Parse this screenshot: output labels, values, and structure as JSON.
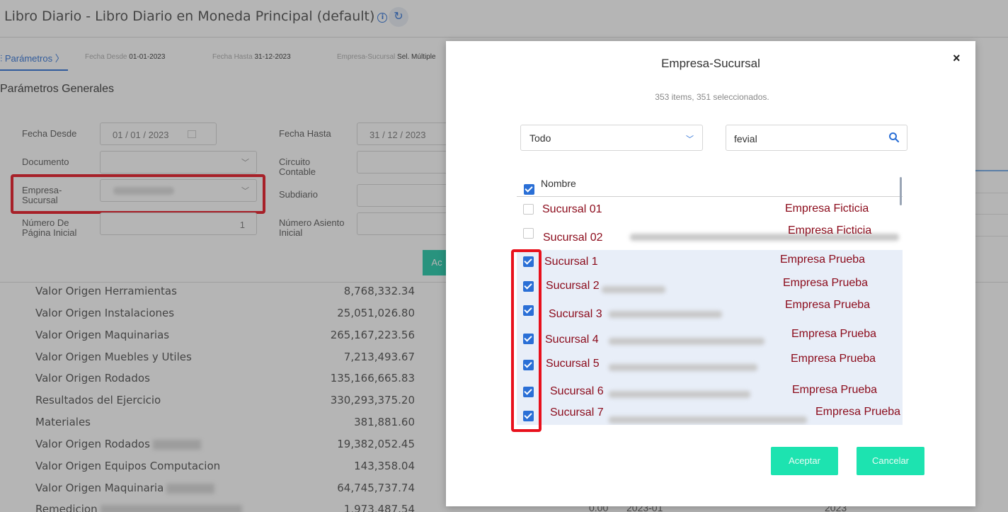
{
  "page": {
    "title": "Libro Diario - Libro Diario en Moneda Principal (default)",
    "param_tab": "Parámetros",
    "param_chips": [
      {
        "label": "Fecha Desde",
        "value": "01-01-2023"
      },
      {
        "label": "Fecha Hasta",
        "value": "31-12-2023"
      },
      {
        "label": "Empresa-Sucursal",
        "value": "Sel. Múltiple"
      }
    ],
    "section_title": "Parámetros Generales",
    "form": {
      "fecha_desde_label": "Fecha Desde",
      "fecha_desde_value": "01 / 01 / 2023",
      "documento_label": "Documento",
      "empresa_sucursal_label": "Empresa-\nSucursal",
      "numero_pagina_label": "Número De\nPágina Inicial",
      "numero_pagina_value": "1",
      "fecha_hasta_label": "Fecha Hasta",
      "fecha_hasta_value": "31 / 12 / 2023",
      "circuito_label": "Circuito\nContable",
      "subdiario_label": "Subdiario",
      "numero_asiento_label": "Número Asiento\nInicial",
      "aceptar_partial": "Ac"
    },
    "rows": [
      {
        "account": "Valor Origen Herramientas",
        "amount": "8,768,332.34"
      },
      {
        "account": "Valor Origen Instalaciones",
        "amount": "25,051,026.80"
      },
      {
        "account": "Valor Origen Maquinarias",
        "amount": "265,167,223.56"
      },
      {
        "account": "Valor Origen Muebles y Utiles",
        "amount": "7,213,493.67"
      },
      {
        "account": "Valor Origen Rodados",
        "amount": "135,166,665.83"
      },
      {
        "account": "Resultados del Ejercicio",
        "amount": "330,293,375.20"
      },
      {
        "account": "Materiales",
        "amount": "381,881.60"
      },
      {
        "account": "Valor Origen Rodados",
        "amount": "19,382,052.45"
      },
      {
        "account": "Valor Origen Equipos Computacion",
        "amount": "143,358.04"
      },
      {
        "account": "Valor Origen Maquinaria",
        "amount": "64,745,737.74"
      },
      {
        "account": "Remedicion",
        "amount": "1,973,487.54"
      }
    ],
    "bottom_extra": {
      "zero": "0.00",
      "period": "2023-01",
      "year": "2023"
    }
  },
  "modal": {
    "title": "Empresa-Sucursal",
    "close_label": "×",
    "subtitle": "353 items, 351 seleccionados.",
    "filter_value": "Todo",
    "search_value": "fevial",
    "column_header": "Nombre",
    "items": [
      {
        "name": "Sucursal 01",
        "company": "Empresa Ficticia",
        "checked": false
      },
      {
        "name": "Sucursal 02",
        "company": "Empresa Ficticia",
        "checked": false
      },
      {
        "name": "Sucursal 1",
        "company": "Empresa Prueba",
        "checked": true
      },
      {
        "name": "Sucursal 2",
        "company": "Empresa Prueba",
        "checked": true
      },
      {
        "name": "Sucursal 3",
        "company": "Empresa Prueba",
        "checked": true
      },
      {
        "name": "Sucursal 4",
        "company": "Empresa Prueba",
        "checked": true
      },
      {
        "name": "Sucursal 5",
        "company": "Empresa Prueba",
        "checked": true
      },
      {
        "name": "Sucursal 6",
        "company": "Empresa Prueba",
        "checked": true
      },
      {
        "name": "Sucursal 7",
        "company": "Empresa Prueba",
        "checked": true
      }
    ],
    "accept_label": "Aceptar",
    "cancel_label": "Cancelar"
  },
  "colors": {
    "accent": "#2a6fd6",
    "highlight_box": "#e8101c",
    "button": "#1de3b0",
    "item_text": "#8b0a1a"
  }
}
